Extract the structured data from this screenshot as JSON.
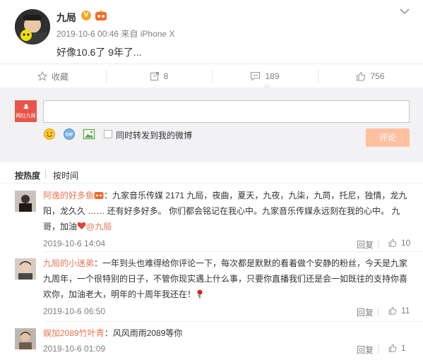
{
  "post": {
    "user": "九局",
    "meta": "2019-10-6 00:46 来自 iPhone X",
    "text": "好像10.6了 9年了..."
  },
  "actions": {
    "favorite": "收藏",
    "repost": "8",
    "comments": "189",
    "likes": "756"
  },
  "composer": {
    "placeholder": "",
    "my_avatar_text": "网红九局",
    "repost_label": "同时转发到我的微博",
    "submit_label": "评论"
  },
  "sort": {
    "hot": "按热度",
    "time": "按时间"
  },
  "comments": [
    {
      "user": "阿逸的好多鱼",
      "text": "：九家音乐传媒  2171 九局，夜曲，夏天，九夜，九柒，九苘，托尼，独情，龙九阳，龙久久 …… 还有好多好多。 你们都会铭记在我心中。九家音乐传媒永远刻在我的心中。       九哥，加油",
      "mention": "@九局",
      "time": "2019-10-6 14:04",
      "reply": "回复",
      "likes": "10"
    },
    {
      "user": "九局的小迷弟",
      "text": "：一年到头也难得给你评论一下，每次都是默默的看着做个安静的粉丝，今天是九家九周年，一个很特别的日子，不管你现实遇上什么事，只要你直播我们还是会一如既往的支持你喜欢你，加油老大，明年的十周年我还在！",
      "time": "2019-10-6 06:50",
      "reply": "回复",
      "likes": "11"
    },
    {
      "user": "娱加2089竹叶青",
      "text": "：风风雨雨2089等你",
      "time": "2019-10-6 01:09",
      "reply": "回复",
      "likes": "1"
    }
  ],
  "colors": {
    "accent": "#eb7350",
    "submit_disabled": "#ffc09f",
    "compose_bg": "#f2f2f5"
  }
}
